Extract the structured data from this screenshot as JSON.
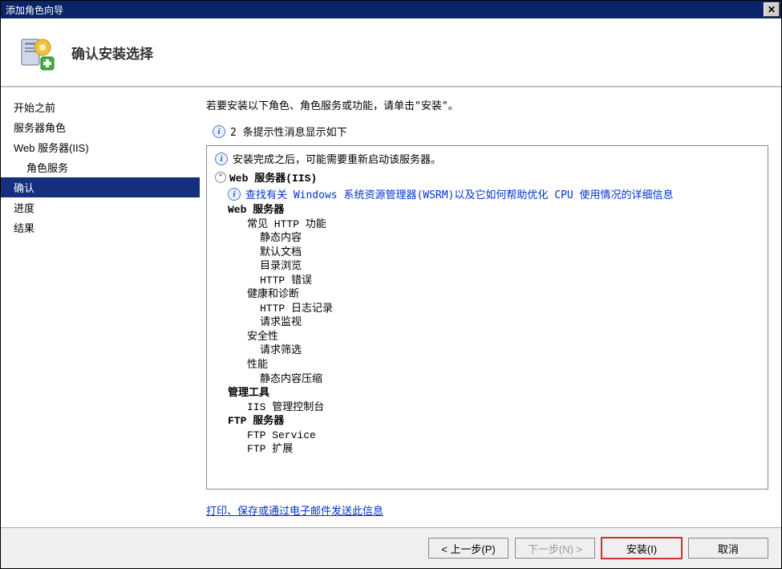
{
  "window": {
    "title": "添加角色向导"
  },
  "header": {
    "title": "确认安装选择"
  },
  "sidebar": {
    "items": [
      {
        "label": "开始之前",
        "indent": false
      },
      {
        "label": "服务器角色",
        "indent": false
      },
      {
        "label": "Web 服务器(IIS)",
        "indent": false
      },
      {
        "label": "角色服务",
        "indent": true
      },
      {
        "label": "确认",
        "indent": false,
        "selected": true
      },
      {
        "label": "进度",
        "indent": false
      },
      {
        "label": "结果",
        "indent": false
      }
    ]
  },
  "main": {
    "intro": "若要安装以下角色、角色服务或功能，请单击\"安装\"。",
    "info_count_line": "2 条提示性消息显示如下",
    "box": {
      "restart_info": "安装完成之后，可能需要重新启动该服务器。",
      "group_title": "Web 服务器(IIS)",
      "wsrm_link": "查找有关 Windows 系统资源管理器(WSRM)以及它如何帮助优化 CPU 使用情况的详细信息",
      "tree": [
        {
          "text": "Web 服务器",
          "level": 1,
          "bold": true
        },
        {
          "text": "常见 HTTP 功能",
          "level": 2
        },
        {
          "text": "静态内容",
          "level": 3
        },
        {
          "text": "默认文档",
          "level": 3
        },
        {
          "text": "目录浏览",
          "level": 3
        },
        {
          "text": "HTTP 错误",
          "level": 3
        },
        {
          "text": "健康和诊断",
          "level": 2
        },
        {
          "text": "HTTP 日志记录",
          "level": 3
        },
        {
          "text": "请求监视",
          "level": 3
        },
        {
          "text": "安全性",
          "level": 2
        },
        {
          "text": "请求筛选",
          "level": 3
        },
        {
          "text": "性能",
          "level": 2
        },
        {
          "text": "静态内容压缩",
          "level": 3
        },
        {
          "text": "管理工具",
          "level": 1,
          "bold": true
        },
        {
          "text": "IIS 管理控制台",
          "level": 2
        },
        {
          "text": "FTP 服务器",
          "level": 1,
          "bold": true
        },
        {
          "text": "FTP Service",
          "level": 2
        },
        {
          "text": "FTP 扩展",
          "level": 2
        }
      ]
    },
    "bottom_link": "打印、保存或通过电子邮件发送此信息"
  },
  "footer": {
    "prev": "< 上一步(P)",
    "next": "下一步(N) >",
    "install": "安装(I)",
    "cancel": "取消"
  }
}
